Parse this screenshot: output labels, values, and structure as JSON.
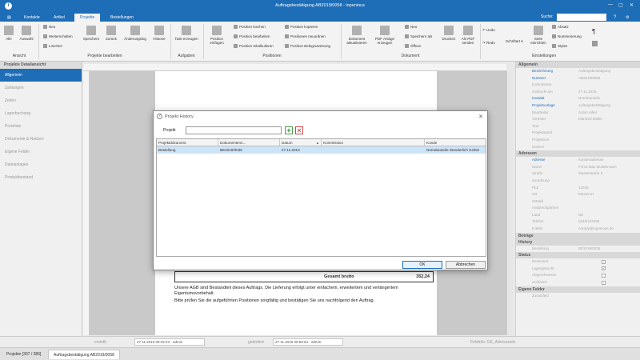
{
  "window": {
    "title": "Auftragsbestätigung AB2019/0058 - inpenious",
    "icon_letter": "i"
  },
  "tabs": [
    {
      "label": "Kontakte"
    },
    {
      "label": "Artikel"
    },
    {
      "label": "Projekte"
    },
    {
      "label": "Bestellungen"
    }
  ],
  "search": {
    "label": "Suche:",
    "value": ""
  },
  "ribbon": {
    "ansicht": {
      "label": "Ansicht",
      "alle": "Alle",
      "auswahl": "Auswahl"
    },
    "projekte_bearbeiten": {
      "label": "Projekte bearbeiten",
      "neu": "Neu",
      "weiterschalten": "Weiterschalten",
      "loeschen": "Löschen",
      "speichern": "Speichern",
      "zurueck": "Zurück",
      "aenderungslog": "Änderungslog",
      "historie": "Historie"
    },
    "aufgaben": {
      "label": "Aufgaben",
      "task": "Task erzeugen"
    },
    "positionen": {
      "label": "Positionen",
      "einfuegen": "Position einfügen",
      "loeschen": "Position löschen",
      "bearbeiten": "Position bearbeiten",
      "rekalkulieren": "Position rekalkulieren",
      "kopieren": "Position kopieren",
      "neuordnen": "Positionen neuordnen",
      "belegzuweisung": "Position Belegzuweisung"
    },
    "dokument": {
      "label": "Dokument",
      "aktualisieren": "Dokument aktualisieren",
      "pdf_anlage": "PDF Anlage erzeugen",
      "neu": "Neu",
      "speichern_als": "Speichern als",
      "oeffnen": "Öffnen",
      "drucken": "Drucken",
      "als_pdf": "Als PDF senden"
    },
    "einstellungen": {
      "label": "Einstellungen",
      "undo": "Undo",
      "redo": "Redo",
      "schriftart": "Schriftart",
      "seite": "Seite einrichten",
      "absatz": "Absatz",
      "nummerierung": "Nummerierung",
      "styles": "Styles",
      "pilcrow": "¶"
    }
  },
  "left_panel": {
    "header": "Projekte Detailansicht",
    "items": [
      {
        "label": "Allgemein"
      },
      {
        "label": "Zahlungen"
      },
      {
        "label": "Zeiten"
      },
      {
        "label": "Lagerbuchung"
      },
      {
        "label": "Preisliste"
      },
      {
        "label": "Dokumente & Notizen"
      },
      {
        "label": "Eigene Felder"
      },
      {
        "label": "Dateianlagen"
      },
      {
        "label": "Produktbestand"
      }
    ]
  },
  "document": {
    "total_label": "Gesamt brutto",
    "total_value": "352,24",
    "terms_1": "Unsere AGB sind Bestandteil dieses Auftrags. Die Lieferung erfolgt unter einfachem, erweitertem und verlängertem Eigentumsvorbehalt.",
    "terms_2": "Bitte prüfen Sie die aufgeführten Positionen sorgfältig und bestätigen Sie uns nachfolgend den Auftrag."
  },
  "dialog": {
    "title": "Projekt History",
    "help_icon": "?",
    "close": "✕",
    "projekt_label": "Projekt",
    "projekt_value": "",
    "add": "+",
    "remove": "✕",
    "columns": [
      "Projektdokument",
      "Dokumentenn...",
      "Datum",
      "Kommission",
      "Kunde"
    ],
    "rows": [
      {
        "projektdokument": "Bestellung",
        "dokumentennr": "BE2019/0035",
        "datum": "27.11.2019",
        "kommission": "",
        "kunde": "Norrabauteile Wunderlich GmbH"
      }
    ],
    "ok": "OK",
    "cancel": "Abbrechen"
  },
  "right_panel": {
    "sections": [
      {
        "title": "Allgemein",
        "rows": [
          {
            "k": "Bezeichnung",
            "v": "Auftragsbestätigung",
            "hl": true
          },
          {
            "k": "Nummer",
            "v": "AB2019/0058",
            "hl": true
          },
          {
            "k": "Kommission",
            "v": ""
          },
          {
            "k": "Gedruckt am",
            "v": "27.11.2019"
          },
          {
            "k": "Kontakt",
            "v": "Norrabauteile",
            "hl": true
          },
          {
            "k": "Projektvorlage",
            "v": "Auftragsbestätigung",
            "hl": true
          },
          {
            "k": "Bearbeiter",
            "v": "Anton Adler"
          },
          {
            "k": "Vertreter",
            "v": "Manfred Müller"
          },
          {
            "k": "Text",
            "v": ""
          },
          {
            "k": "Projektstand",
            "v": ""
          },
          {
            "k": "Projektsort",
            "v": ""
          },
          {
            "k": "Notizen",
            "v": ""
          }
        ]
      },
      {
        "title": "Adressen",
        "rows": [
          {
            "k": "Adresse",
            "v": "Kundenadresse",
            "hl": true
          },
          {
            "k": "Name",
            "v": "Firma Max Mustermann"
          },
          {
            "k": "Straße",
            "v": "Musterstraße 3"
          },
          {
            "k": "Zuordnung",
            "v": ""
          },
          {
            "k": "PLZ",
            "v": "12345"
          },
          {
            "k": "Ort",
            "v": "Musterort"
          },
          {
            "k": "Ortsteil",
            "v": ""
          },
          {
            "k": "Ansprechpartner",
            "v": ""
          },
          {
            "k": "Land",
            "v": "DE"
          },
          {
            "k": "Telefon",
            "v": "0345/123456"
          },
          {
            "k": "E-Mail",
            "v": "norrply@ingenious.de"
          }
        ]
      },
      {
        "title": "Beträge",
        "rows": []
      },
      {
        "title": "History",
        "rows": [
          {
            "k": "Bestellung",
            "v": "BE2019/0035"
          }
        ]
      },
      {
        "title": "Status",
        "rows": [
          {
            "k": "Reserviert",
            "v": "",
            "cb": true
          },
          {
            "k": "Lagergebucht",
            "v": "",
            "cb": true,
            "checked": true
          },
          {
            "k": "Abgeschlossen",
            "v": "",
            "cb": true
          },
          {
            "k": "Archiviert",
            "v": "",
            "cb": true
          }
        ]
      },
      {
        "title": "Eigene Felder",
        "rows": [
          {
            "k": "Zusatzfeld",
            "v": ""
          }
        ]
      }
    ]
  },
  "statusbar": {
    "erstellt_label": "erstellt",
    "erstellt_value": "27.11.2019 09:32:23 - admin",
    "geaendert_label": "geändert",
    "geaendert_value": "27.11.2019 09:59:54 - admin",
    "feldinfo": "Feldinfo: GE_Adresszeile"
  },
  "bottom_tabs": [
    {
      "label": "Projekte [307 / 386]"
    },
    {
      "label": "Auftragsbestätigung AB2019/0058"
    }
  ]
}
